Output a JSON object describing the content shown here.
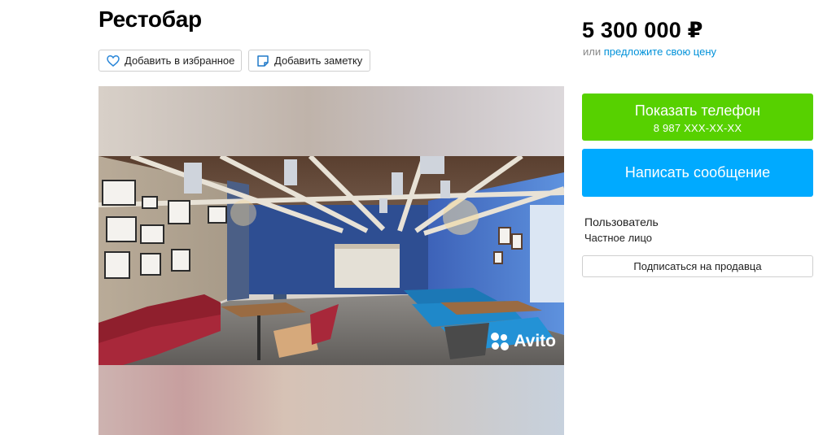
{
  "breadcrumbs": "· · · · · ·",
  "listing": {
    "title": "Рестобар",
    "favorite_label": "Добавить в избранное",
    "note_label": "Добавить заметку",
    "watermark": "Avito"
  },
  "pricing": {
    "price": "5 300 000 ₽",
    "offer_prefix": "или",
    "offer_link": "предложите свою цену"
  },
  "contact": {
    "phone_button_label": "Показать телефон",
    "phone_masked": "8 987 XXX-XX-XX",
    "message_button_label": "Написать сообщение"
  },
  "seller": {
    "name": "Пользователь",
    "type": "Частное лицо",
    "subscribe_label": "Подписаться на продавца"
  },
  "icons": {
    "favorite": "heart-icon",
    "note": "sticky-note-icon",
    "avito": "avito-logo-icon"
  },
  "colors": {
    "phone_button": "#57d100",
    "message_button": "#00aaff",
    "link": "#0091d9",
    "favorite_icon": "#2a86d8",
    "note_icon": "#1f78c8"
  }
}
